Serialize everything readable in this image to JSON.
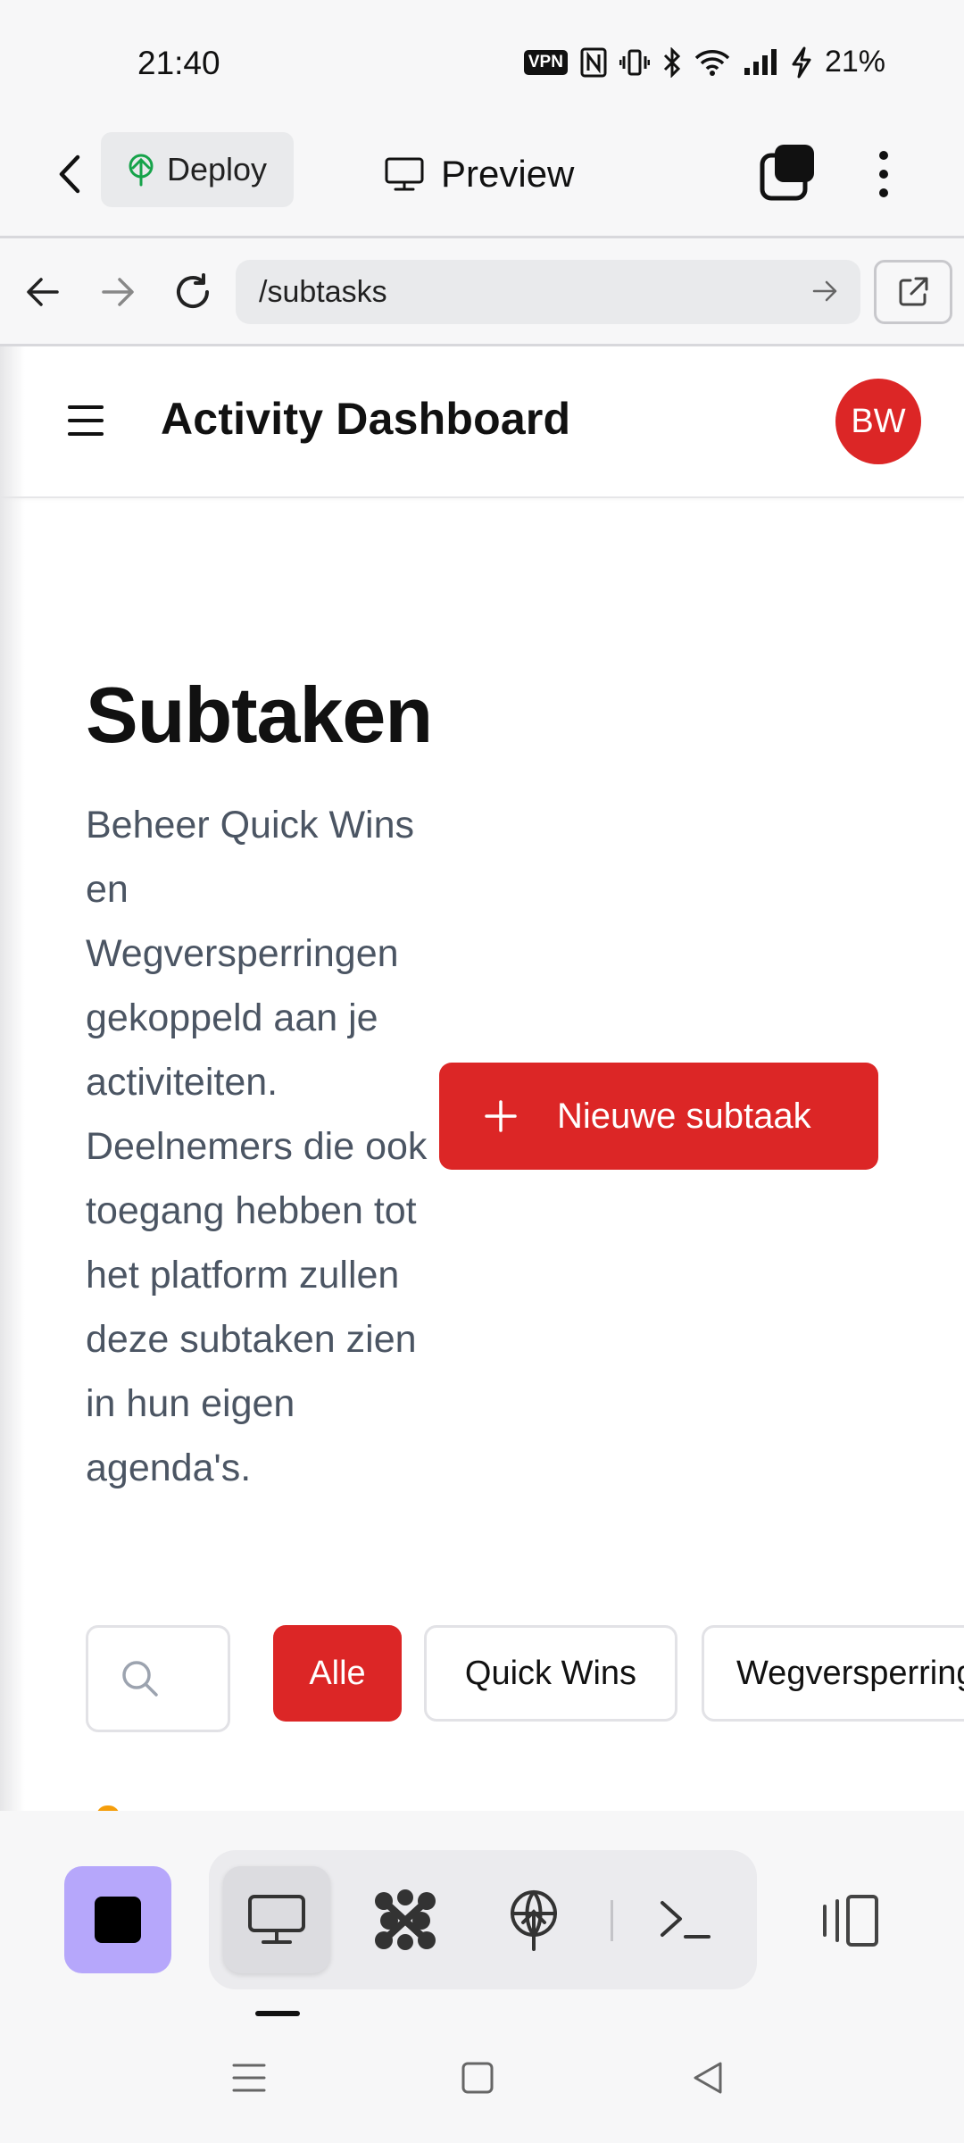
{
  "status": {
    "time": "21:40",
    "vpn": "VPN",
    "battery": "21%"
  },
  "app_header": {
    "deploy_label": "Deploy",
    "preview_label": "Preview"
  },
  "browser": {
    "url": "/subtasks"
  },
  "site": {
    "title": "Activity Dashboard",
    "avatar_initials": "BW"
  },
  "page": {
    "title": "Subtaken",
    "description": "Beheer Quick Wins en Wegversperringen gekoppeld aan je activiteiten. Deelnemers die ook toegang hebben tot het platform zullen deze subtaken zien in hun eigen agenda's.",
    "new_button": "Nieuwe subtaak"
  },
  "filters": {
    "chips": [
      "Alle",
      "Quick Wins",
      "Wegversperringen"
    ]
  },
  "colors": {
    "accent": "#dc2626",
    "stop_button": "#b6a7fb"
  }
}
